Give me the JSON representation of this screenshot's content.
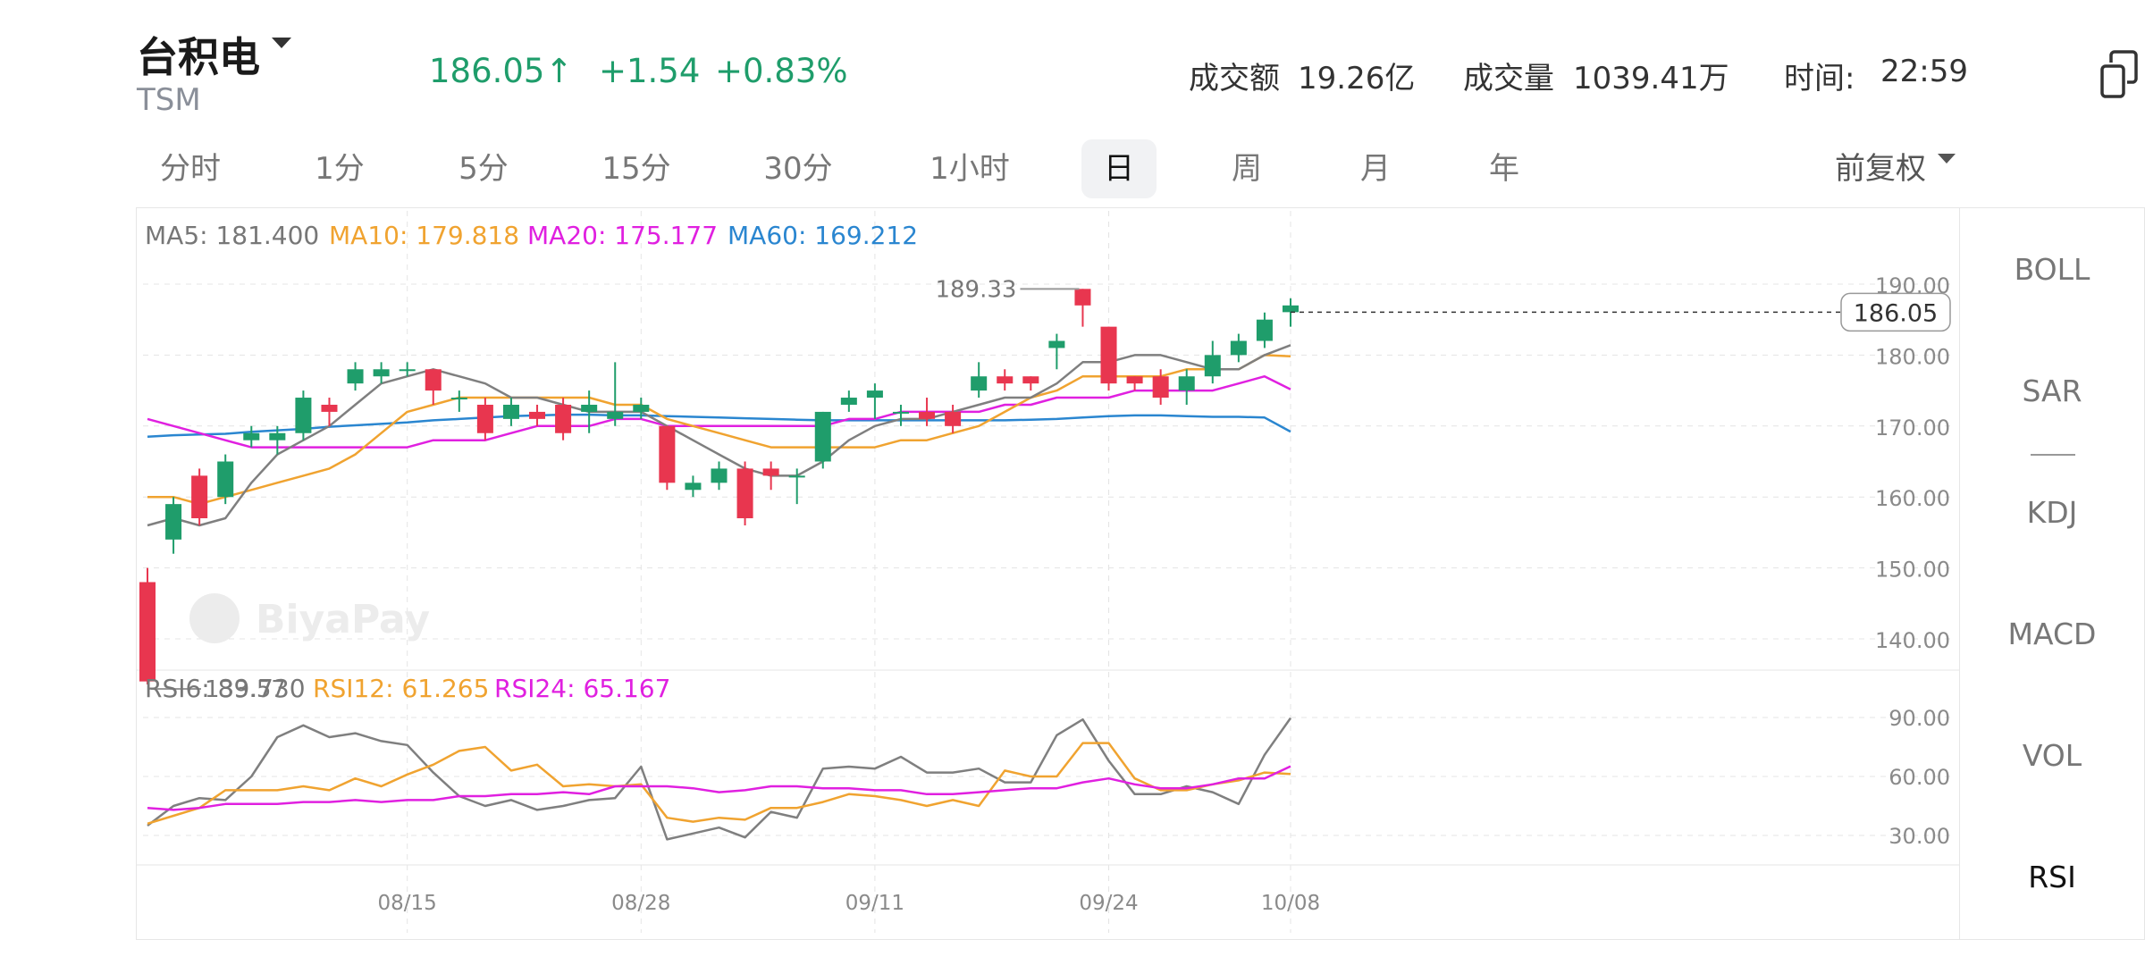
{
  "header": {
    "name": "台积电",
    "ticker": "TSM",
    "price": "186.05",
    "arrow": "↑",
    "change": "+1.54",
    "change_pct": "+0.83%",
    "turnover_label": "成交额",
    "turnover_value": "19.26亿",
    "volume_label": "成交量",
    "volume_value": "1039.41万",
    "time_label": "时间:",
    "time_value": "22:59"
  },
  "tabs": [
    "分时",
    "1分",
    "5分",
    "15分",
    "30分",
    "1小时",
    "日",
    "周",
    "月",
    "年"
  ],
  "active_tab": "日",
  "adjust_label": "前复权",
  "indicators": [
    "BOLL",
    "SAR",
    "KDJ",
    "MACD",
    "VOL",
    "RSI"
  ],
  "active_indicator": "RSI",
  "watermark": "BiyaPay",
  "colors": {
    "up": "#1f9d6b",
    "down": "#e8364f",
    "ma5": "#7f7f7f",
    "ma10": "#f0a330",
    "ma20": "#e020e0",
    "ma60": "#2a86d0"
  },
  "chart_data": [
    {
      "type": "candlestick",
      "legend": [
        {
          "name": "MA5",
          "text": "MA5: 181.400"
        },
        {
          "name": "MA10",
          "text": "MA10: 179.818"
        },
        {
          "name": "MA20",
          "text": "MA20: 175.177"
        },
        {
          "name": "MA60",
          "text": "MA60: 169.212"
        }
      ],
      "ylim": [
        133,
        192
      ],
      "yticks": [
        "190.00",
        "180.00",
        "170.00",
        "160.00",
        "150.00",
        "140.00"
      ],
      "x_labels": [
        "08/15",
        "08/28",
        "09/11",
        "09/24",
        "10/08"
      ],
      "last_price_label": "186.05",
      "max_label": "189.33",
      "min_label": "133.57",
      "candles": [
        [
          148,
          134,
          150,
          133.57
        ],
        [
          154,
          159,
          160,
          152
        ],
        [
          163,
          157,
          164,
          156
        ],
        [
          160,
          165,
          166,
          159
        ],
        [
          168,
          169,
          170,
          167
        ],
        [
          168,
          169,
          170,
          166
        ],
        [
          169,
          174,
          175,
          168
        ],
        [
          173,
          172,
          174,
          170
        ],
        [
          176,
          178,
          179,
          175
        ],
        [
          177,
          178,
          179,
          176
        ],
        [
          178,
          178,
          179,
          177
        ],
        [
          178,
          175,
          178,
          173
        ],
        [
          174,
          174,
          175,
          172
        ],
        [
          173,
          169,
          174,
          168
        ],
        [
          171,
          173,
          174,
          170
        ],
        [
          172,
          171,
          173,
          170
        ],
        [
          173,
          169,
          174,
          168
        ],
        [
          172,
          173,
          175,
          169
        ],
        [
          171,
          172,
          179,
          170
        ],
        [
          172,
          173,
          174,
          171
        ],
        [
          170,
          162,
          170,
          161
        ],
        [
          161,
          162,
          163,
          160
        ],
        [
          162,
          164,
          165,
          161
        ],
        [
          164,
          157,
          165,
          156
        ],
        [
          164,
          163,
          165,
          161
        ],
        [
          163,
          163,
          164,
          159
        ],
        [
          165,
          172,
          172,
          164
        ],
        [
          173,
          174,
          175,
          172
        ],
        [
          174,
          175,
          176,
          171
        ],
        [
          172,
          172,
          173,
          170
        ],
        [
          172,
          171,
          174,
          170
        ],
        [
          172,
          170,
          173,
          169
        ],
        [
          175,
          177,
          179,
          174
        ],
        [
          177,
          176,
          178,
          175
        ],
        [
          177,
          176,
          177,
          175
        ],
        [
          181,
          182,
          183,
          178
        ],
        [
          189.33,
          187,
          189.33,
          184
        ],
        [
          184,
          176,
          184,
          175
        ],
        [
          177,
          176,
          177,
          175
        ],
        [
          177,
          174,
          178,
          173
        ],
        [
          175,
          177,
          178,
          173
        ],
        [
          177,
          180,
          182,
          176
        ],
        [
          180,
          182,
          183,
          179
        ],
        [
          182,
          185,
          186,
          181
        ],
        [
          186.05,
          187,
          188,
          184
        ]
      ],
      "ma5": [
        156,
        157,
        156,
        157,
        162,
        166,
        168,
        170,
        173,
        176,
        177,
        178,
        177,
        176,
        174,
        174,
        173,
        172,
        172,
        172,
        170,
        168,
        166,
        164,
        163,
        163,
        165,
        168,
        170,
        171,
        171,
        172,
        173,
        174,
        174,
        176,
        179,
        179,
        180,
        180,
        179,
        178,
        178,
        180,
        181.4
      ],
      "ma10": [
        160,
        160,
        159,
        160,
        161,
        162,
        163,
        164,
        166,
        169,
        172,
        173,
        174,
        174,
        174,
        174,
        174,
        174,
        173,
        173,
        171,
        170,
        169,
        168,
        167,
        167,
        167,
        167,
        167,
        168,
        168,
        169,
        170,
        172,
        174,
        175,
        177,
        177,
        177,
        177,
        178,
        178,
        178,
        180,
        179.818
      ],
      "ma20": [
        171,
        170,
        169,
        168,
        167,
        167,
        167,
        167,
        167,
        167,
        167,
        168,
        168,
        168,
        169,
        170,
        170,
        170,
        171,
        171,
        170,
        170,
        170,
        170,
        170,
        170,
        170,
        171,
        171,
        172,
        172,
        172,
        172,
        173,
        173,
        174,
        174,
        174,
        175,
        175,
        175,
        175,
        176,
        177,
        175.177
      ],
      "ma60": [
        168.5,
        168.7,
        168.8,
        168.9,
        169.2,
        169.4,
        169.6,
        169.9,
        170.1,
        170.3,
        170.5,
        170.8,
        171,
        171.2,
        171.4,
        171.5,
        171.6,
        171.6,
        171.5,
        171.5,
        171.4,
        171.3,
        171.2,
        171.1,
        171,
        170.9,
        170.8,
        170.8,
        170.8,
        170.8,
        170.8,
        170.8,
        170.8,
        170.8,
        170.9,
        171,
        171.2,
        171.4,
        171.5,
        171.5,
        171.4,
        171.3,
        171.3,
        171.2,
        169.212
      ]
    },
    {
      "type": "line",
      "legend": [
        {
          "name": "RSI6",
          "text": "RSI6: 89.730"
        },
        {
          "name": "RSI12",
          "text": "RSI12: 61.265"
        },
        {
          "name": "RSI24",
          "text": "RSI24: 65.167"
        }
      ],
      "ylim": [
        20,
        100
      ],
      "yticks": [
        "90.00",
        "60.00",
        "30.00"
      ],
      "series": [
        {
          "name": "RSI6",
          "values": [
            35,
            45,
            49,
            48,
            60,
            80,
            86,
            80,
            82,
            78,
            76,
            62,
            50,
            45,
            48,
            43,
            45,
            48,
            49,
            65,
            28,
            31,
            34,
            29,
            42,
            39,
            64,
            65,
            64,
            70,
            62,
            62,
            64,
            57,
            57,
            81,
            89,
            68,
            51,
            51,
            55,
            52,
            46,
            71,
            89.73
          ]
        },
        {
          "name": "RSI12",
          "values": [
            36,
            40,
            44,
            53,
            53,
            53,
            55,
            53,
            59,
            55,
            61,
            66,
            73,
            75,
            63,
            66,
            55,
            56,
            55,
            56,
            39,
            37,
            39,
            38,
            44,
            44,
            47,
            51,
            50,
            48,
            45,
            48,
            45,
            63,
            60,
            60,
            77,
            77,
            59,
            53,
            53,
            56,
            58,
            62,
            61.265
          ]
        },
        {
          "name": "RSI24",
          "values": [
            44,
            43,
            44,
            46,
            46,
            46,
            47,
            47,
            48,
            47,
            48,
            48,
            50,
            50,
            51,
            51,
            52,
            51,
            55,
            55,
            55,
            54,
            52,
            53,
            55,
            55,
            54,
            54,
            53,
            53,
            51,
            51,
            52,
            53,
            54,
            54,
            57,
            59,
            56,
            54,
            54,
            56,
            59,
            59,
            65.167
          ]
        }
      ]
    }
  ]
}
